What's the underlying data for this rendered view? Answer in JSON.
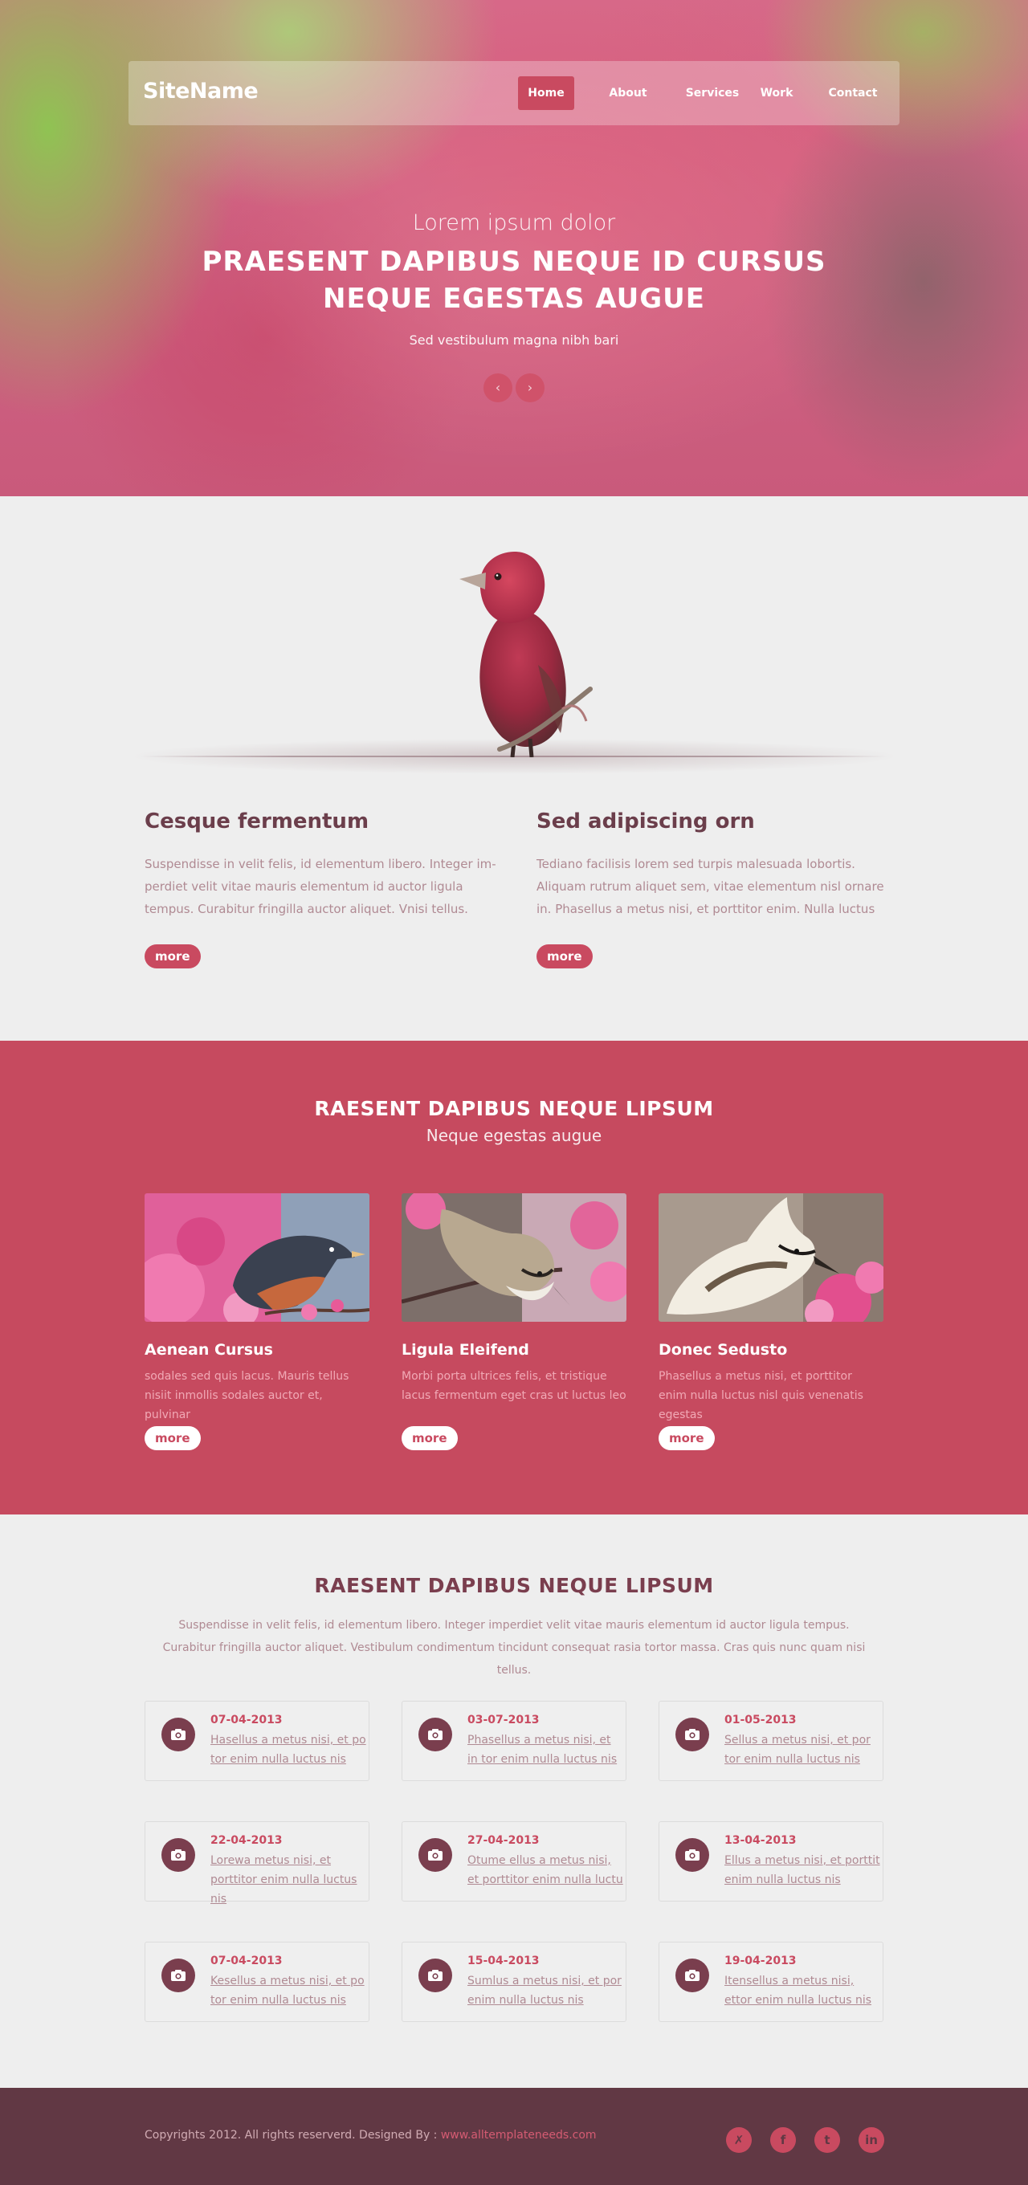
{
  "site": {
    "name": "SiteName"
  },
  "nav": {
    "items": [
      {
        "label": "Home",
        "active": true
      },
      {
        "label": "About"
      },
      {
        "label": "Services"
      },
      {
        "label": "Work"
      },
      {
        "label": "Contact"
      }
    ]
  },
  "hero": {
    "kicker": "Lorem ipsum dolor",
    "title": "PRAESENT DAPIBUS NEQUE ID CURSUS NEQUE EGESTAS AUGUE",
    "subtitle": "Sed vestibulum magna nibh bari",
    "prev_glyph": "‹",
    "next_glyph": "›"
  },
  "intro": {
    "columns": [
      {
        "title": "Cesque fermentum",
        "text": "Suspendisse in velit felis, id elementum libero. Integer im-perdiet velit vitae mauris elementum id auctor ligula tempus. Curabitur fringilla auctor aliquet. Vnisi tellus.",
        "button": "more"
      },
      {
        "title": "Sed adipiscing orn",
        "text": "Tediano facilisis lorem sed turpis malesuada lobortis. Aliquam rutrum aliquet sem, vitae elementum nisl ornare in. Phasellus a metus nisi, et porttitor enim. Nulla luctus",
        "button": "more"
      }
    ]
  },
  "gallery": {
    "title": "RAESENT DAPIBUS NEQUE LIPSUM",
    "subtitle": "Neque egestas augue",
    "cards": [
      {
        "title": "Aenean Cursus",
        "text": "sodales sed quis lacus. Mauris tellus nisiit inmollis sodales auctor et, pulvinar",
        "button": "more"
      },
      {
        "title": "Ligula Eleifend",
        "text": "Morbi porta ultrices felis, et tristique lacus fermentum eget  cras ut luctus leo",
        "button": "more"
      },
      {
        "title": "Donec Sedusto",
        "text": "Phasellus a metus nisi, et porttitor enim nulla luctus nisl quis venenatis egestas",
        "button": "more"
      }
    ]
  },
  "news": {
    "title": "RAESENT DAPIBUS NEQUE LIPSUM",
    "intro": "Suspendisse in velit felis, id elementum libero. Integer imperdiet velit vitae mauris elementum id auctor ligula tempus. Curabitur fringilla auctor aliquet. Vestibulum condimentum tincidunt consequat rasia tortor massa. Cras quis nunc quam  nisi tellus.",
    "items": [
      {
        "date": "07-04-2013",
        "text": "Hasellus a metus nisi, et po tor enim nulla luctus nis"
      },
      {
        "date": "03-07-2013",
        "text": "Phasellus a metus nisi, et in tor enim nulla luctus nis"
      },
      {
        "date": "01-05-2013",
        "text": "Sellus a metus nisi, et por tor enim nulla luctus nis"
      },
      {
        "date": "22-04-2013",
        "text": "Lorewa metus nisi, et porttitor enim nulla luctus nis"
      },
      {
        "date": "27-04-2013",
        "text": "Otume ellus a metus nisi, et porttitor enim nulla luctu"
      },
      {
        "date": "13-04-2013",
        "text": "Ellus a metus nisi, et porttit enim nulla luctus nis"
      },
      {
        "date": "07-04-2013",
        "text": "Kesellus a metus nisi, et po tor enim nulla luctus nis"
      },
      {
        "date": "15-04-2013",
        "text": "Sumlus a metus nisi, et por enim nulla luctus nis"
      },
      {
        "date": "19-04-2013",
        "text": "Itensellus a metus nisi, ettor enim nulla luctus nis"
      }
    ]
  },
  "footer": {
    "copyright": "Copyrights 2012. All rights reserverd. Designed By :",
    "link": "www.alltemplateneeds.com",
    "social": [
      {
        "icon": "person-icon",
        "glyph": "✗"
      },
      {
        "icon": "facebook-icon",
        "glyph": "f"
      },
      {
        "icon": "twitter-icon",
        "glyph": "t"
      },
      {
        "icon": "linkedin-icon",
        "glyph": "in"
      }
    ]
  },
  "colors": {
    "accent": "#c94a60",
    "section_pink": "#c64a5f",
    "heading_plum": "#6b3e4b",
    "footer_bg": "#613844",
    "body_bg": "#eeeeee",
    "muted_text": "#b08a93"
  }
}
